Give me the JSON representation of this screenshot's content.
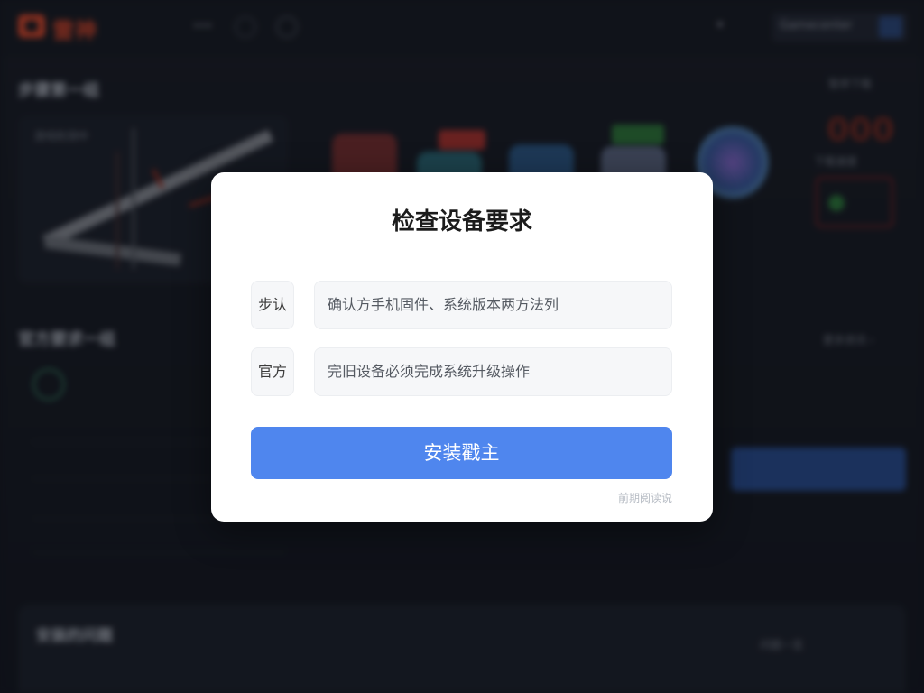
{
  "background": {
    "logo_text": "雷神",
    "top_pill": "•••",
    "top_caret": "▾",
    "search_text": "Gamecenter",
    "section1_title": "步骤第一组",
    "section1_right": "暂停下载",
    "card_caption": "游戏检测中",
    "big_number": "000",
    "stat_caption": "下载速度",
    "section2_title": "官方要求一组",
    "section2_right": "更多资讯 ›",
    "bottom_title": "安装的问题",
    "bottom_right": "问题一览"
  },
  "dialog": {
    "title": "检查设备要求",
    "rows": [
      {
        "label": "步认",
        "value": "确认方手机固件、系统版本两方法列"
      },
      {
        "label": "官方",
        "value": "完旧设备必须完成系统升级操作"
      }
    ],
    "primary_button": "安装戳主",
    "footer_link": "前期阅读说"
  },
  "colors": {
    "accent": "#4f86ee",
    "brand_red": "#e24a2c",
    "background": "#14171f",
    "dialog_bg": "#ffffff"
  },
  "icons": [
    "logo-icon",
    "globe-icon",
    "settings-icon",
    "search-icon",
    "chevron-down-icon"
  ]
}
